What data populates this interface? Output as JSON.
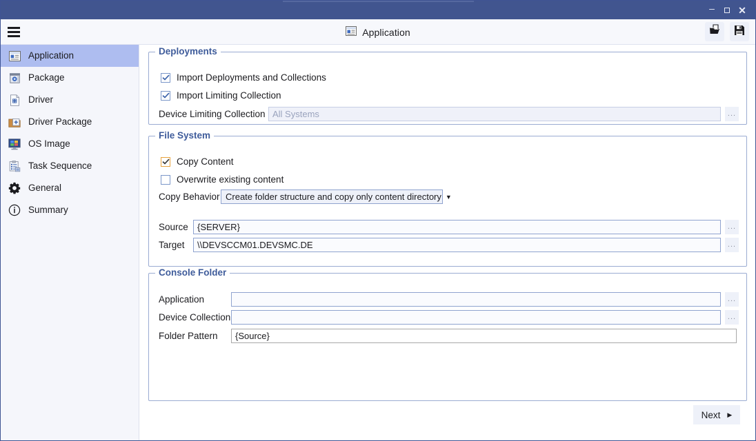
{
  "window": {
    "minimize_label": "–",
    "maximize_label": "□",
    "close_label": "✕"
  },
  "header": {
    "menu_icon": "hamburger-icon",
    "title": "Application",
    "title_icon": "application-icon",
    "open_icon": "open-folder-icon",
    "save_icon": "save-disk-icon"
  },
  "sidebar": {
    "items": [
      {
        "label": "Application",
        "icon": "application-icon",
        "selected": true
      },
      {
        "label": "Package",
        "icon": "package-icon",
        "selected": false
      },
      {
        "label": "Driver",
        "icon": "driver-icon",
        "selected": false
      },
      {
        "label": "Driver Package",
        "icon": "driver-package-icon",
        "selected": false
      },
      {
        "label": "OS Image",
        "icon": "os-image-icon",
        "selected": false
      },
      {
        "label": "Task Sequence",
        "icon": "task-sequence-icon",
        "selected": false
      },
      {
        "label": "General",
        "icon": "gear-icon",
        "selected": false
      },
      {
        "label": "Summary",
        "icon": "info-icon",
        "selected": false
      }
    ]
  },
  "deployments": {
    "legend": "Deployments",
    "import_deployments": {
      "label": "Import Deployments and Collections",
      "checked": true
    },
    "import_limiting": {
      "label": "Import Limiting Collection",
      "checked": true
    },
    "device_limiting_collection": {
      "label": "Device Limiting Collection",
      "value": "",
      "placeholder": "All Systems",
      "browse_label": "..."
    }
  },
  "file_system": {
    "legend": "File System",
    "copy_content": {
      "label": "Copy Content",
      "checked": true
    },
    "overwrite_existing": {
      "label": "Overwrite existing content",
      "checked": false
    },
    "copy_behavior": {
      "label": "Copy Behavior",
      "value": "Create folder structure and copy only content directory"
    },
    "source": {
      "label": "Source",
      "value": "{SERVER}",
      "browse_label": "..."
    },
    "target": {
      "label": "Target",
      "value": "\\\\DEVSCCM01.DEVSMC.DE",
      "browse_label": "..."
    }
  },
  "console_folder": {
    "legend": "Console Folder",
    "application": {
      "label": "Application",
      "value": "",
      "browse_label": "..."
    },
    "device_collection": {
      "label": "Device Collection",
      "value": "",
      "browse_label": "..."
    },
    "folder_pattern": {
      "label": "Folder Pattern",
      "value": "{Source}"
    }
  },
  "footer": {
    "next_label": "Next",
    "next_arrow": "▶"
  },
  "colors": {
    "titlebar": "#41558f",
    "sidebar_selected": "#aebdf0",
    "group_border": "#9aabd2",
    "legend_text": "#3f5c9b",
    "checkbox_blue": "#7b97c9",
    "checkbox_amber": "#e8a33d"
  }
}
